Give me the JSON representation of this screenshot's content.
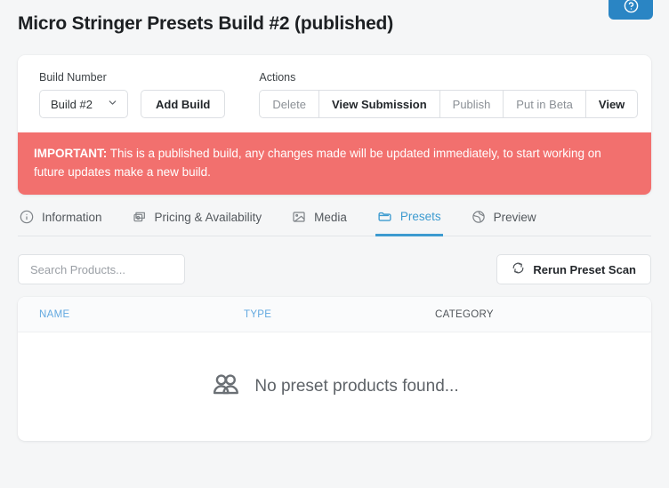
{
  "header": {
    "title": "Micro Stringer Presets Build #2 (published)",
    "help_icon": "question-circle-icon",
    "help_color": "#2a85c4"
  },
  "build_section": {
    "build_number_label": "Build Number",
    "build_select_value": "Build #2",
    "chevron_icon": "chevron-down-icon",
    "add_build_label": "Add Build",
    "actions_label": "Actions",
    "action_buttons": [
      {
        "label": "Delete",
        "enabled": false
      },
      {
        "label": "View Submission",
        "enabled": true
      },
      {
        "label": "Publish",
        "enabled": false
      },
      {
        "label": "Put in Beta",
        "enabled": false
      },
      {
        "label": "View",
        "enabled": true
      }
    ]
  },
  "alert": {
    "prefix": "IMPORTANT:",
    "message": " This is a published build, any changes made will be updated immediately, to start working on future updates make a new build.",
    "background": "#f2706e"
  },
  "tabs": [
    {
      "label": "Information",
      "icon": "info-circle-icon",
      "active": false
    },
    {
      "label": "Pricing & Availability",
      "icon": "money-icon",
      "active": false
    },
    {
      "label": "Media",
      "icon": "image-icon",
      "active": false
    },
    {
      "label": "Presets",
      "icon": "folder-icon",
      "active": true
    },
    {
      "label": "Preview",
      "icon": "globe-icon",
      "active": false
    }
  ],
  "active_tab_color": "#3d9bd0",
  "toolbar": {
    "search_placeholder": "Search Products...",
    "search_value": "",
    "rerun_label": "Rerun Preset Scan",
    "rerun_icon": "refresh-icon"
  },
  "table": {
    "columns": [
      {
        "label": "NAME",
        "sortable": true
      },
      {
        "label": "TYPE",
        "sortable": true
      },
      {
        "label": "CATEGORY",
        "sortable": false
      }
    ],
    "rows": [],
    "empty_text": "No preset products found...",
    "empty_icon": "users-icon"
  }
}
